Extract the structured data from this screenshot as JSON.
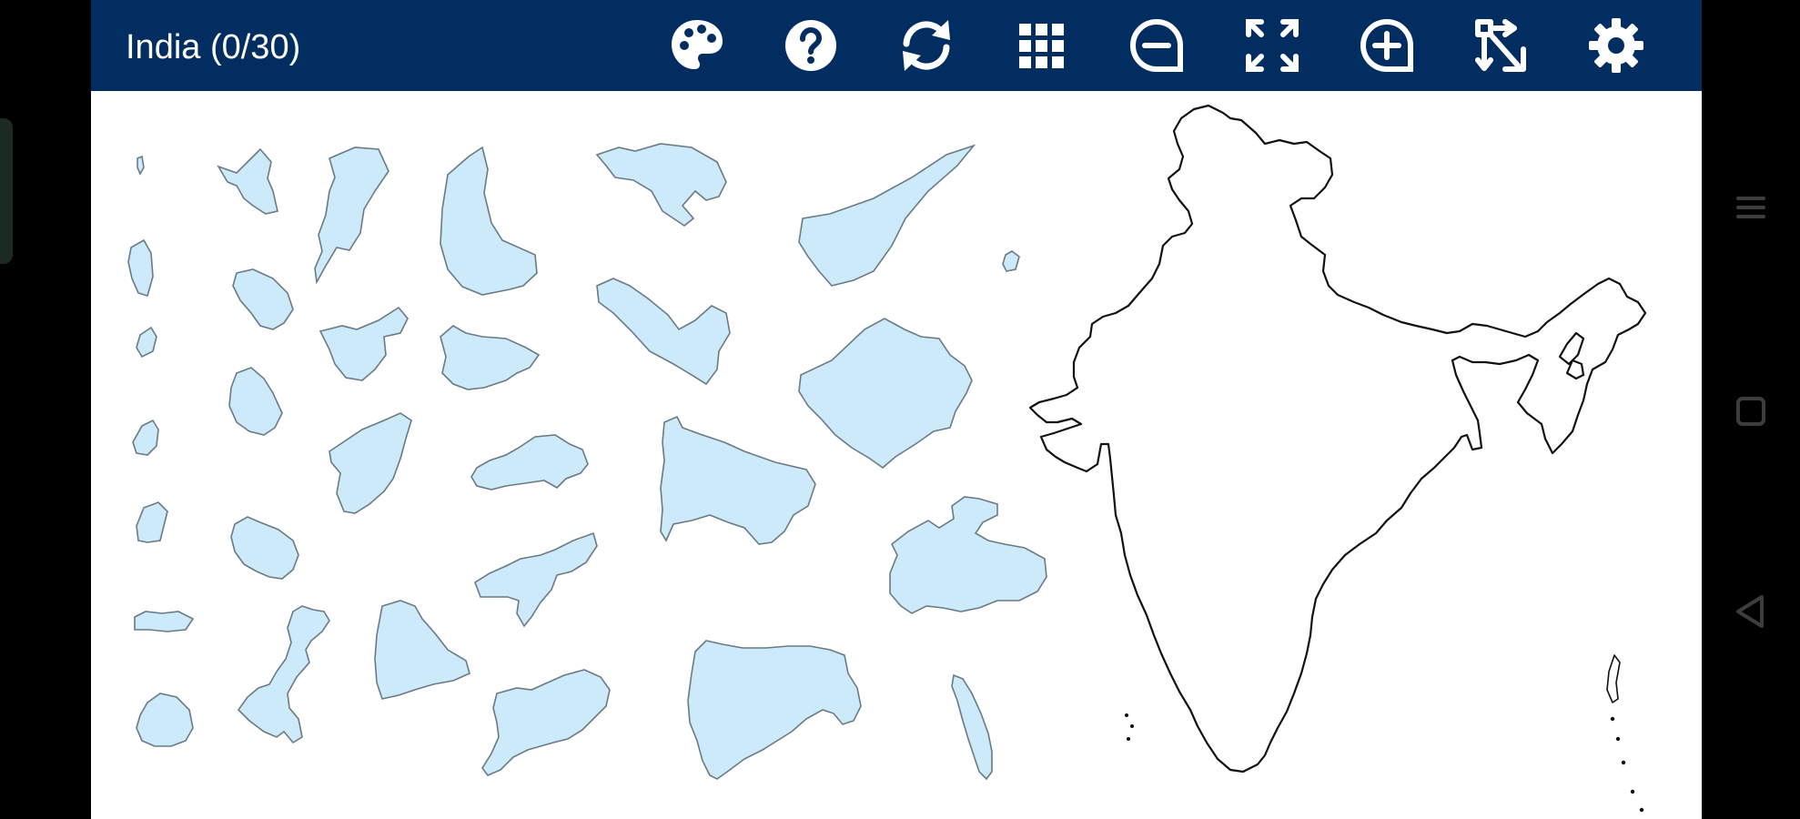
{
  "app": {
    "title": "India (0/30)"
  },
  "toolbar": {
    "buttons": [
      {
        "name": "palette",
        "icon": "palette-icon"
      },
      {
        "name": "help",
        "icon": "help-icon"
      },
      {
        "name": "restart",
        "icon": "refresh-icon"
      },
      {
        "name": "grid",
        "icon": "grid-icon"
      },
      {
        "name": "zoom-out",
        "icon": "zoom-out-icon"
      },
      {
        "name": "fullscreen",
        "icon": "expand-icon"
      },
      {
        "name": "zoom-in",
        "icon": "zoom-in-icon"
      },
      {
        "name": "shuffle",
        "icon": "arrange-icon"
      },
      {
        "name": "settings",
        "icon": "gear-icon"
      }
    ]
  },
  "puzzle": {
    "placed": 0,
    "total": 30,
    "piece_fill": "#cdeafb",
    "piece_stroke": "#6a7a82",
    "outline_color": "#111111"
  },
  "colors": {
    "topbar": "#012d61",
    "board": "#ffffff"
  },
  "system_nav": {
    "buttons": [
      {
        "name": "menu",
        "icon": "menu-icon"
      },
      {
        "name": "home",
        "icon": "square-icon"
      },
      {
        "name": "back",
        "icon": "back-triangle-icon"
      }
    ]
  }
}
